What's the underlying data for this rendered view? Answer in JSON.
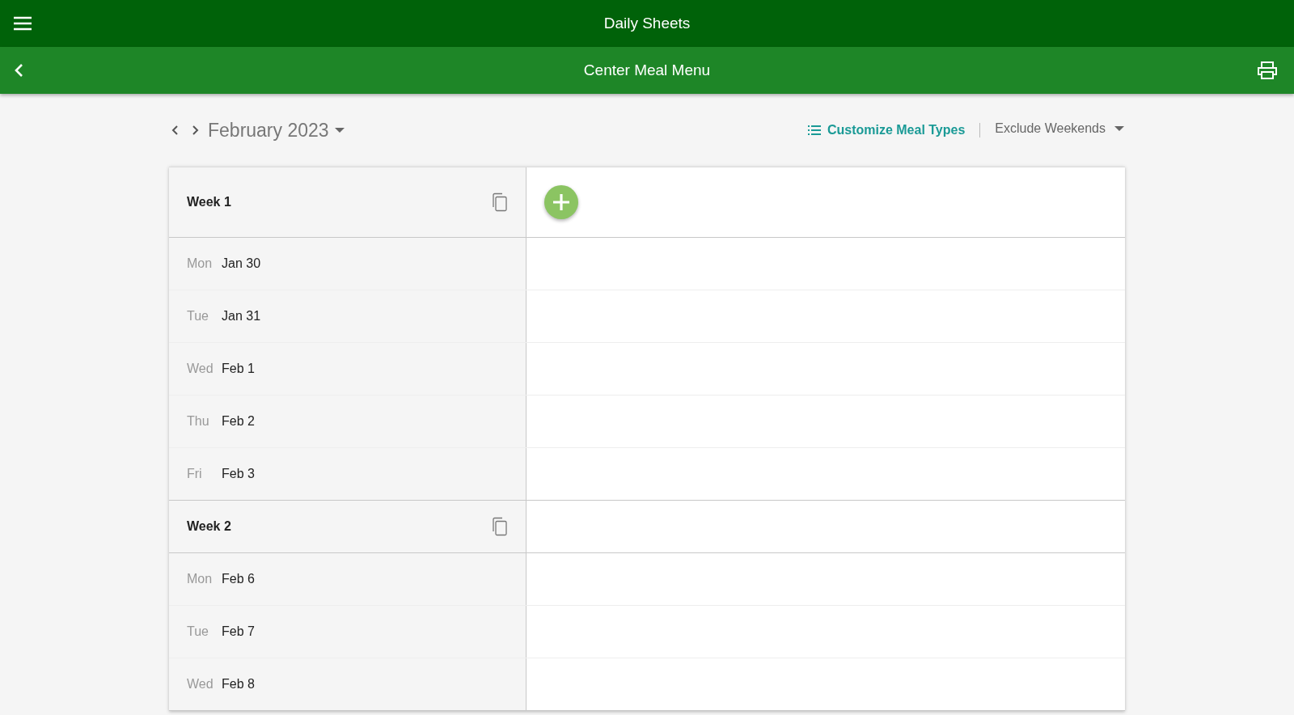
{
  "app_bar": {
    "title": "Daily Sheets"
  },
  "sub_bar": {
    "title": "Center Meal Menu"
  },
  "toolbar": {
    "month": "February 2023",
    "customize": "Customize Meal Types",
    "weekend_filter": "Exclude Weekends"
  },
  "weeks": [
    {
      "label": "Week 1",
      "add_button_visible": true,
      "days": [
        {
          "weekday": "Mon",
          "date": "Jan 30"
        },
        {
          "weekday": "Tue",
          "date": "Jan 31"
        },
        {
          "weekday": "Wed",
          "date": "Feb 1"
        },
        {
          "weekday": "Thu",
          "date": "Feb 2"
        },
        {
          "weekday": "Fri",
          "date": "Feb 3"
        }
      ]
    },
    {
      "label": "Week 2",
      "add_button_visible": false,
      "days": [
        {
          "weekday": "Mon",
          "date": "Feb 6"
        },
        {
          "weekday": "Tue",
          "date": "Feb 7"
        },
        {
          "weekday": "Wed",
          "date": "Feb 8"
        }
      ]
    }
  ]
}
